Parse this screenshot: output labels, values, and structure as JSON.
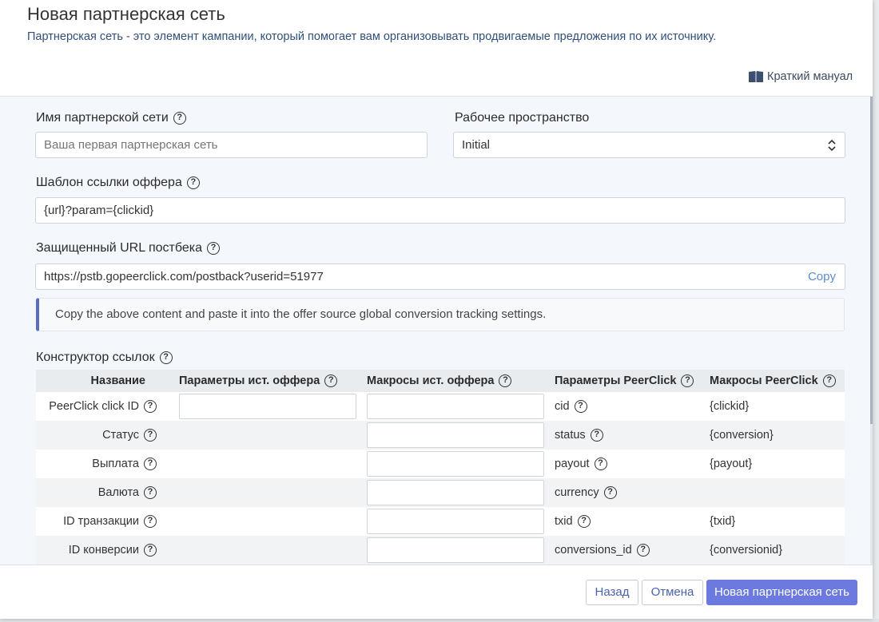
{
  "header": {
    "title": "Новая партнерская сеть",
    "description": "Партнерская сеть - это элемент кампании, который помогает вам организовывать продвигаемые предложения по их источнику.",
    "manual_link": "Краткий манual"
  },
  "form": {
    "network_name": {
      "label": "Имя партнерской сети",
      "placeholder": "Ваша первая партнерская сеть",
      "value": ""
    },
    "workspace": {
      "label": "Рабочее пространство",
      "value": "Initial"
    },
    "offer_template": {
      "label": "Шаблон ссылки оффера",
      "value": "{url}?param={clickid}"
    },
    "postback": {
      "label": "Защищенный URL постбека",
      "value": "https://pstb.gopeerclick.com/postback?userid=51977",
      "copy_label": "Copy"
    },
    "info_text": "Copy the above content and paste it into the offer source global conversion tracking settings."
  },
  "link_builder": {
    "title": "Конструктор ссылок",
    "columns": [
      "Название",
      "Параметры ист. оффера",
      "Макросы ист. оффера",
      "Параметры PeerClick",
      "Макросы PeerClick"
    ],
    "rows": [
      {
        "name": "PeerClick click ID",
        "param": "cid",
        "macro": "{clickid}"
      },
      {
        "name": "Статус",
        "param": "status",
        "macro": "{conversion}"
      },
      {
        "name": "Выплата",
        "param": "payout",
        "macro": "{payout}"
      },
      {
        "name": "Валюта",
        "param": "currency",
        "macro": ""
      },
      {
        "name": "ID транзакции",
        "param": "txid",
        "macro": "{txid}"
      },
      {
        "name": "ID конверсии",
        "param": "conversions_id",
        "macro": "{conversionid}"
      }
    ]
  },
  "footer": {
    "back": "Назад",
    "cancel": "Отмена",
    "submit": "Новая партнерская сеть"
  },
  "colors": {
    "primary": "#6c7ae0",
    "accent_border": "#5b6bc0",
    "link": "#5b8bd0"
  }
}
